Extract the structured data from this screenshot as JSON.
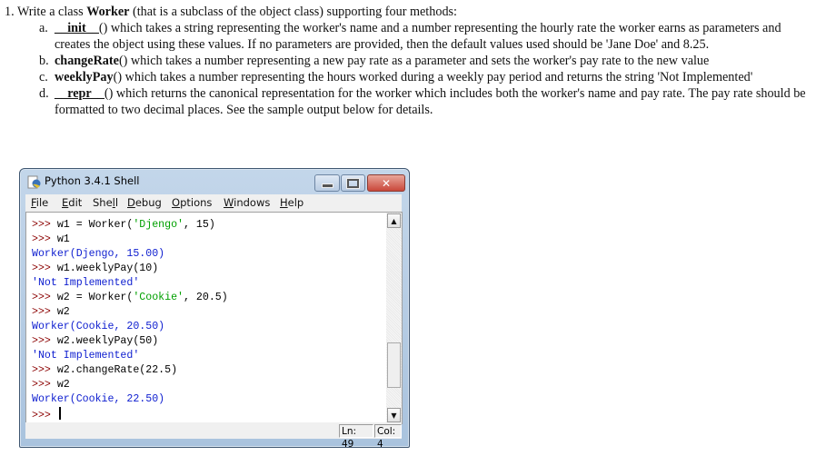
{
  "question": {
    "number": "1.",
    "intro_pre": "Write a class ",
    "intro_bold": "Worker",
    "intro_post": " (that is a subclass of the object class) supporting four methods:",
    "items": [
      {
        "letter": "a.",
        "method": "__init__",
        "lines": [
          "() which takes a string representing the worker's name and a number representing the hourly rate the worker earns as",
          "parameters and creates the object using these values. If no parameters are provided, then the default values used should be 'Jane",
          "Doe' and 8.25."
        ]
      },
      {
        "letter": "b.",
        "method": "changeRate",
        "lines": [
          "() which takes a number representing a new pay rate as a parameter and sets the worker's pay rate to the new value"
        ]
      },
      {
        "letter": "c.",
        "method": "weeklyPay",
        "lines": [
          "() which takes a number representing the hours worked during a weekly pay period and returns the string 'Not",
          "Implemented'"
        ]
      },
      {
        "letter": "d.",
        "method": "__repr__",
        "lines": [
          "() which returns the canonical representation for the worker which includes both the worker's name and pay rate. The pay",
          "rate should be formatted to two decimal places. See the sample output below for details."
        ]
      }
    ]
  },
  "window": {
    "title": "Python 3.4.1 Shell",
    "app_icon": "python-idle-icon",
    "controls": {
      "minimize": "minimize-icon",
      "maximize": "maximize-icon",
      "close": "close-icon"
    },
    "menu": [
      {
        "label_pre": "",
        "accel": "F",
        "label_post": "ile"
      },
      {
        "label_pre": "",
        "accel": "E",
        "label_post": "dit"
      },
      {
        "label_pre": "She",
        "accel": "l",
        "label_post": "l"
      },
      {
        "label_pre": "",
        "accel": "D",
        "label_post": "ebug"
      },
      {
        "label_pre": "",
        "accel": "O",
        "label_post": "ptions"
      },
      {
        "label_pre": "",
        "accel": "W",
        "label_post": "indows"
      },
      {
        "label_pre": "",
        "accel": "H",
        "label_post": "elp"
      }
    ],
    "console": {
      "prompt": ">>>",
      "lines": [
        {
          "type": "input",
          "pre": "w1 = Worker(",
          "str": "'Djengo'",
          "post": ", 15)"
        },
        {
          "type": "input",
          "pre": "w1",
          "str": "",
          "post": ""
        },
        {
          "type": "output",
          "text": "Worker(Djengo, 15.00)"
        },
        {
          "type": "input",
          "pre": "w1.weeklyPay(10)",
          "str": "",
          "post": ""
        },
        {
          "type": "output",
          "text": "'Not Implemented'"
        },
        {
          "type": "input",
          "pre": "w2 = Worker(",
          "str": "'Cookie'",
          "post": ", 20.5)"
        },
        {
          "type": "input",
          "pre": "w2",
          "str": "",
          "post": ""
        },
        {
          "type": "output",
          "text": "Worker(Cookie, 20.50)"
        },
        {
          "type": "input",
          "pre": "w2.weeklyPay(50)",
          "str": "",
          "post": ""
        },
        {
          "type": "output",
          "text": "'Not Implemented'"
        },
        {
          "type": "input",
          "pre": "w2.changeRate(22.5)",
          "str": "",
          "post": ""
        },
        {
          "type": "input",
          "pre": "w2",
          "str": "",
          "post": ""
        },
        {
          "type": "output",
          "text": "Worker(Cookie, 22.50)"
        },
        {
          "type": "current",
          "pre": "",
          "str": "",
          "post": ""
        }
      ]
    },
    "scrollbar": {
      "up": "scroll-up-arrow-icon",
      "down": "scroll-down-arrow-icon",
      "position_fraction": 0.85
    },
    "status": {
      "line": "Ln: 49",
      "col": "Col: 4"
    }
  }
}
